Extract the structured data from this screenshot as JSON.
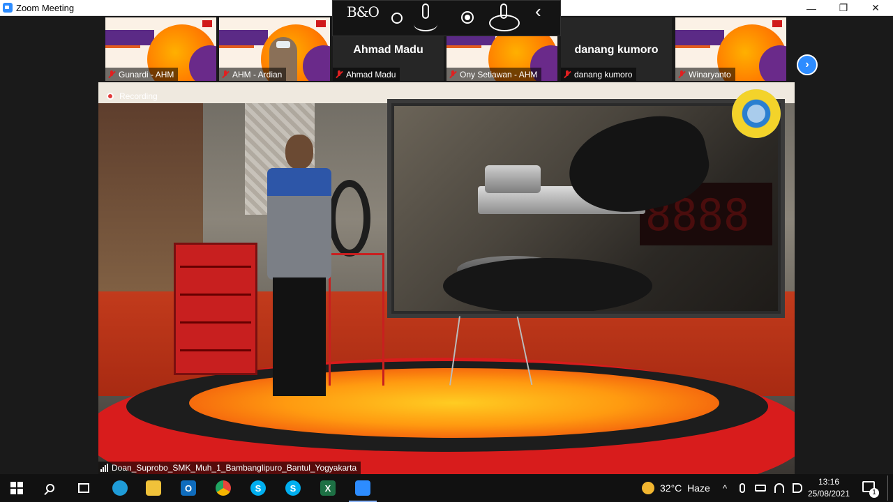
{
  "window": {
    "title": "Zoom Meeting",
    "controls": {
      "minimize": "—",
      "maximize": "❐",
      "close": "✕"
    }
  },
  "headphones_overlay": {
    "brand": "B&O"
  },
  "gallery": {
    "participants": [
      {
        "name": "Gunardi - AHM",
        "muted": true,
        "display": "slide"
      },
      {
        "name": "AHM - Ardian",
        "muted": true,
        "display": "slide-video"
      },
      {
        "name": "Ahmad Madu",
        "muted": true,
        "display": "name",
        "big_name": "Ahmad Madu"
      },
      {
        "name": "Ony Setiawan - AHM",
        "muted": true,
        "display": "slide"
      },
      {
        "name": "danang kumoro",
        "muted": true,
        "display": "name",
        "big_name": "danang kumoro"
      },
      {
        "name": "Winaryanto",
        "muted": true,
        "display": "slide"
      }
    ],
    "next_icon": "chevron-right-icon",
    "next_glyph": "›"
  },
  "main_video": {
    "recording_label": "Recording",
    "speaker_name": "Doan_Suprobo_SMK_Muh_1_Bambanglipuro_Bantul_Yogyakarta"
  },
  "taskbar": {
    "apps": [
      {
        "name": "start",
        "icon": "windows-icon"
      },
      {
        "name": "search",
        "icon": "search-icon"
      },
      {
        "name": "task-view",
        "icon": "task-view-icon"
      },
      {
        "name": "edge",
        "icon": "edge-icon",
        "color": "#1f9cd8"
      },
      {
        "name": "file-explorer",
        "icon": "folder-icon",
        "color": "#f0c23a"
      },
      {
        "name": "outlook",
        "icon": "outlook-icon",
        "color": "#0f6cbd",
        "glyph": "O"
      },
      {
        "name": "chrome",
        "icon": "chrome-icon",
        "color": "#e8453c"
      },
      {
        "name": "skype",
        "icon": "skype-icon",
        "color": "#00aff0",
        "glyph": "S"
      },
      {
        "name": "skype-2",
        "icon": "skype-icon",
        "color": "#00aff0",
        "glyph": "S"
      },
      {
        "name": "excel",
        "icon": "excel-icon",
        "color": "#1d7044",
        "glyph": "X"
      },
      {
        "name": "zoom",
        "icon": "zoom-icon",
        "color": "#2d8cff",
        "active": true
      }
    ],
    "weather": {
      "temp": "32°C",
      "condition": "Haze"
    },
    "clock": {
      "time": "13:16",
      "date": "25/08/2021"
    },
    "notifications": {
      "count": "1"
    },
    "tray_chevron": "^"
  }
}
